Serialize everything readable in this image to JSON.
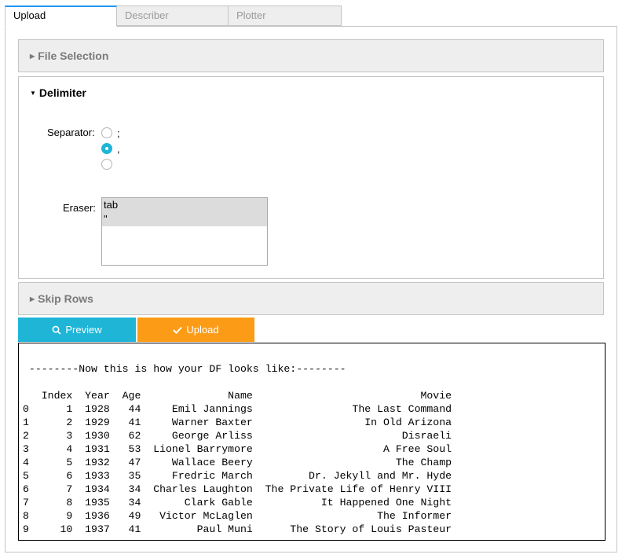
{
  "tabs": [
    {
      "label": "Upload",
      "active": true
    },
    {
      "label": "Describer",
      "active": false
    },
    {
      "label": "Plotter",
      "active": false
    }
  ],
  "file_selection": {
    "title": "File Selection"
  },
  "delimiter": {
    "title": "Delimiter",
    "separator_label": "Separator:",
    "options": [
      {
        "label": ";",
        "checked": false
      },
      {
        "label": ",",
        "checked": true
      },
      {
        "label": "",
        "checked": false
      }
    ],
    "eraser_label": "Eraser:",
    "eraser_options": [
      "tab",
      "\""
    ]
  },
  "skip_rows": {
    "title": "Skip Rows"
  },
  "buttons": {
    "preview": "Preview",
    "upload": "Upload"
  },
  "output": {
    "heading": "--------Now this is how your DF looks like:--------",
    "columns": [
      "Index",
      "Year",
      "Age",
      "Name",
      "Movie"
    ],
    "rows": [
      [
        0,
        1,
        1928,
        44,
        "Emil Jannings",
        "The Last Command"
      ],
      [
        1,
        2,
        1929,
        41,
        "Warner Baxter",
        "In Old Arizona"
      ],
      [
        2,
        3,
        1930,
        62,
        "George Arliss",
        "Disraeli"
      ],
      [
        3,
        4,
        1931,
        53,
        "Lionel Barrymore",
        "A Free Soul"
      ],
      [
        4,
        5,
        1932,
        47,
        "Wallace Beery",
        "The Champ"
      ],
      [
        5,
        6,
        1933,
        35,
        "Fredric March",
        "Dr. Jekyll and Mr. Hyde"
      ],
      [
        6,
        7,
        1934,
        34,
        "Charles Laughton",
        "The Private Life of Henry VIII"
      ],
      [
        7,
        8,
        1935,
        34,
        "Clark Gable",
        "It Happened One Night"
      ],
      [
        8,
        9,
        1936,
        49,
        "Victor McLaglen",
        "The Informer"
      ],
      [
        9,
        10,
        1937,
        41,
        "Paul Muni",
        "The Story of Louis Pasteur"
      ]
    ]
  },
  "colors": {
    "accent": "#2196f3",
    "preview_button": "#1eb5d7",
    "upload_button": "#fc9b16"
  }
}
